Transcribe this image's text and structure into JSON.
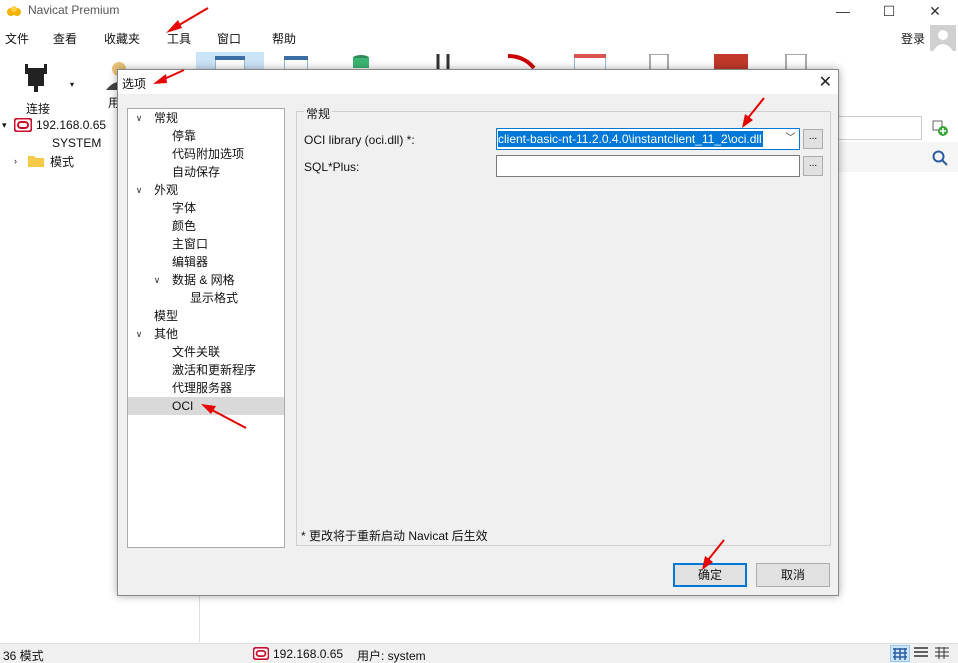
{
  "app": {
    "title": "Navicat Premium"
  },
  "window_controls": {
    "minimize": "—",
    "maximize": "☐",
    "close": "✕"
  },
  "menu": [
    "文件",
    "查看",
    "收藏夹",
    "工具",
    "窗口",
    "帮助"
  ],
  "login_label": "登录",
  "toolbar": {
    "connect_label": "连接",
    "user_label": "用"
  },
  "tree": {
    "connection": "192.168.0.65",
    "schema_system": "SYSTEM",
    "schemas": "模式"
  },
  "statusbar": {
    "count": "36 模式",
    "connection": "192.168.0.65",
    "user": "用户: system"
  },
  "dialog": {
    "title": "选项",
    "close_glyph": "✕",
    "tree_items": [
      {
        "label": "常规",
        "level": 0,
        "expander": "v"
      },
      {
        "label": "停靠",
        "level": 1
      },
      {
        "label": "代码附加选项",
        "level": 1
      },
      {
        "label": "自动保存",
        "level": 1
      },
      {
        "label": "外观",
        "level": 0,
        "expander": "v"
      },
      {
        "label": "字体",
        "level": 1
      },
      {
        "label": "颜色",
        "level": 1
      },
      {
        "label": "主窗口",
        "level": 1
      },
      {
        "label": "编辑器",
        "level": 1
      },
      {
        "label": "数据 & 网格",
        "level": 1,
        "expander": "v"
      },
      {
        "label": "显示格式",
        "level": 2
      },
      {
        "label": "模型",
        "level": 0
      },
      {
        "label": "其他",
        "level": 0,
        "expander": "v"
      },
      {
        "label": "文件关联",
        "level": 1
      },
      {
        "label": "激活和更新程序",
        "level": 1
      },
      {
        "label": "代理服务器",
        "level": 1
      },
      {
        "label": "OCI",
        "level": 1,
        "selected": true
      }
    ],
    "section_title": "常规",
    "oci_library_label": "OCI library (oci.dll) *:",
    "oci_library_value": "client-basic-nt-11.2.0.4.0\\instantclient_11_2\\oci.dll",
    "sqlplus_label": "SQL*Plus:",
    "sqlplus_value": "",
    "browse_label": "...",
    "note": "* 更改将于重新启动 Navicat 后生效",
    "ok_label": "确定",
    "cancel_label": "取消"
  },
  "colors": {
    "accent": "#0078d7",
    "annotation_red": "#e60000",
    "connection_red": "#c8102e"
  }
}
